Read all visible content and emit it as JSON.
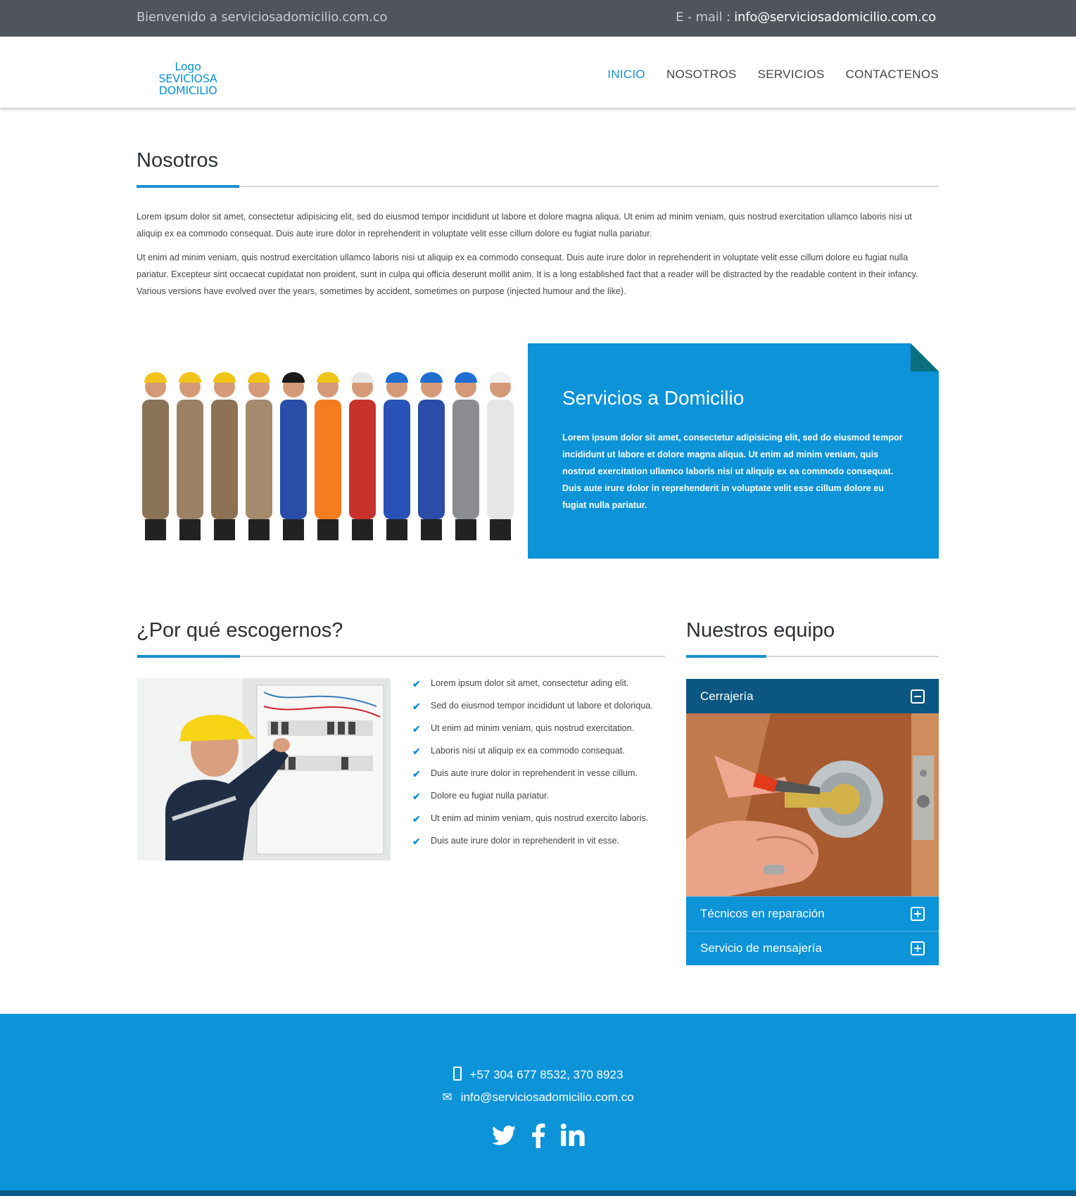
{
  "topbar": {
    "welcome": "Bienvenido a serviciosadomicilio.com.co",
    "email_label": "E - mail : ",
    "email": "info@serviciosadomicilio.com.co"
  },
  "header": {
    "logo": "Logo SEVICIOSA DOMICILIO",
    "nav": [
      "INICIO",
      "NOSOTROS",
      "SERVICIOS",
      "CONTACTENOS"
    ],
    "active": "INICIO"
  },
  "about": {
    "title": "Nosotros",
    "p1": "Lorem ipsum dolor sit amet, consectetur adipisicing elit, sed do eiusmod tempor incididunt ut labore et dolore magna aliqua. Ut enim ad minim veniam, quis nostrud exercitation ullamco laboris nisi ut aliquip ex ea commodo consequat. Duis aute irure dolor in reprehenderit in voluptate velit esse cillum dolore eu fugiat nulla pariatur.",
    "p2": "Ut enim ad minim veniam, quis nostrud exercitation ullamco laboris nisi ut aliquip ex ea commodo consequat. Duis aute irure dolor in reprehenderit in voluptate velit esse cillum dolore eu fugiat nulla pariatur. Excepteur sint occaecat cupidatat non proident, sunt in culpa qui officia deserunt mollit anim. It is a long established fact that a reader will be distracted by the readable content in their infancy. Various versions have evolved over the years, sometimes by accident, sometimes on purpose (injected humour and the like)."
  },
  "services": {
    "title": "Servicios a Domicilio",
    "text": "Lorem ipsum dolor sit amet, consectetur adipisicing elit, sed do eiusmod tempor incididunt ut labore et dolore magna aliqua. Ut enim ad minim veniam, quis nostrud exercitation ullamco laboris nisi ut aliquip ex ea commodo consequat. Duis aute irure dolor in reprehenderit in voluptate velit esse cillum dolore eu fugiat nulla pariatur."
  },
  "why": {
    "title": "¿Por qué escogernos?",
    "items": [
      "Lorem ipsum dolor sit amet, consectetur ading elit.",
      "Sed do eiusmod tempor incididunt ut labore et doloriqua.",
      "Ut enim ad minim veniam, quis nostrud exercitation.",
      "Laboris nisi ut aliquip ex ea commodo consequat.",
      "Duis aute irure dolor in reprehenderit in vesse cillum.",
      "Dolore eu fugiat nulla pariatur.",
      "Ut enim ad minim veniam, quis nostrud exercito laboris.",
      "Duis aute irure dolor in reprehenderit in vit esse."
    ]
  },
  "team": {
    "title": "Nuestros equipo",
    "panels": [
      "Cerrajería",
      "Técnicos en reparación",
      "Servicio de mensajería"
    ]
  },
  "footer": {
    "phone": "+57 304 677 8532, 370 8923",
    "email": "info@serviciosadomicilio.com.co",
    "social_icons": [
      "twitter-icon",
      "facebook-icon",
      "linkedin-icon"
    ]
  },
  "colors": {
    "brand_blue": "#0c93d8",
    "dark_blue": "#0b5781",
    "topbar": "#50545c"
  }
}
